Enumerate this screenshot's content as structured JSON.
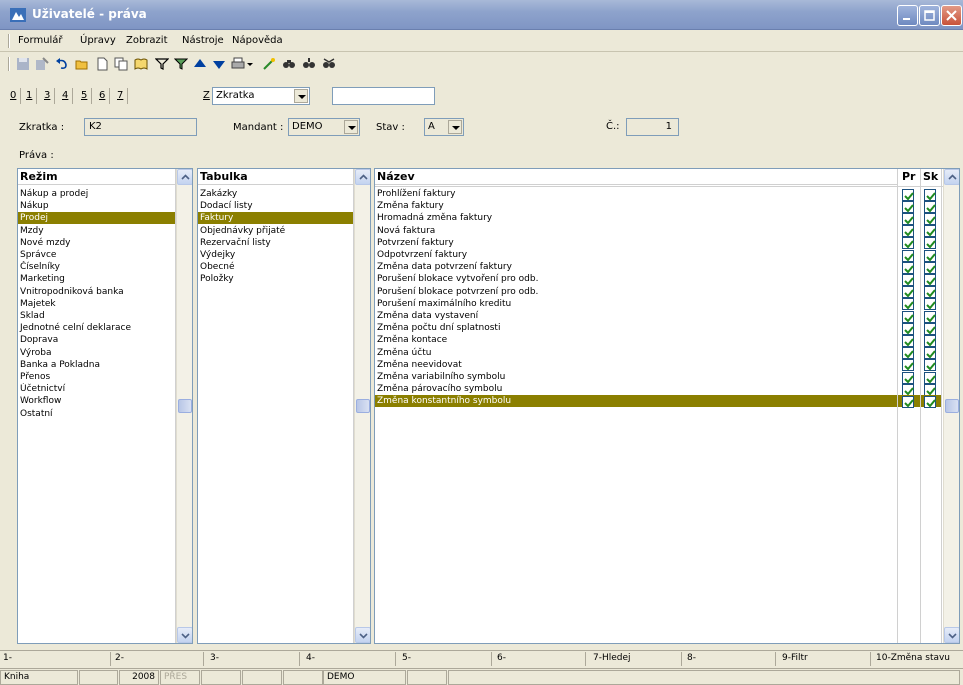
{
  "window": {
    "title": "Uživatelé - práva"
  },
  "menu": [
    "Formulář",
    "Úpravy",
    "Zobrazit",
    "Nástroje",
    "Nápověda"
  ],
  "filter": {
    "tabs": [
      "0",
      "1",
      "3",
      "4",
      "5",
      "6",
      "7"
    ],
    "key_label": "Z",
    "sort_combo": "Zkratka",
    "search_value": ""
  },
  "fields": {
    "zkratka_label": "Zkratka :",
    "zkratka_value": "K2",
    "mandant_label": "Mandant :",
    "mandant_value": "DEMO",
    "stav_label": "Stav :",
    "stav_value": "A",
    "cislo_label": "Č.:",
    "cislo_value": "1"
  },
  "rights_label": "Práva :",
  "rezim": {
    "header": "Režim",
    "items": [
      "Nákup a prodej",
      "Nákup",
      "Prodej",
      "Mzdy",
      "Nové mzdy",
      "Správce",
      "Číselníky",
      "Marketing",
      "Vnitropodniková banka",
      "Majetek",
      "Sklad",
      "Jednotné celní deklarace",
      "Doprava",
      "Výroba",
      "Banka a Pokladna",
      "Přenos",
      "Účetnictví",
      "Workflow",
      "Ostatní"
    ],
    "selected": 2
  },
  "tabulka": {
    "header": "Tabulka",
    "items": [
      "Zakázky",
      "Dodací listy",
      "Faktury",
      "Objednávky přijaté",
      "Rezervační listy",
      "Výdejky",
      "Obecné",
      "Položky"
    ],
    "selected": 2
  },
  "nazev": {
    "header": "Název",
    "col_pr": "Pr",
    "col_sk": "Sk",
    "items": [
      "Prohlížení faktury",
      "Změna faktury",
      "Hromadná změna faktury",
      "Nová faktura",
      "Potvrzení faktury",
      "Odpotvrzení faktury",
      "Změna data potvrzení faktury",
      "Porušení blokace vytvoření pro odb.",
      "Porušení blokace potvrzení pro odb.",
      "Porušení maximálního kreditu",
      "Změna data vystavení",
      "Změna počtu dní splatnosti",
      "Změna kontace",
      "Změna účtu",
      "Změna neevidovat",
      "Změna variabilního symbolu",
      "Změna párovacího symbolu",
      "Změna konstantního symbolu"
    ],
    "selected": 17
  },
  "fkeys": [
    "1-",
    "2-",
    "3-",
    "4-",
    "5-",
    "6-",
    "7-Hledej",
    "8-",
    "9-Filtr",
    "10-Změna stavu"
  ],
  "status": [
    "Kniha",
    "",
    "2008",
    "PŘES",
    "",
    "",
    "",
    "DEMO",
    "",
    ""
  ],
  "colors": {
    "selection": "#8b7f00",
    "titlebar": "#8ea3cc"
  }
}
